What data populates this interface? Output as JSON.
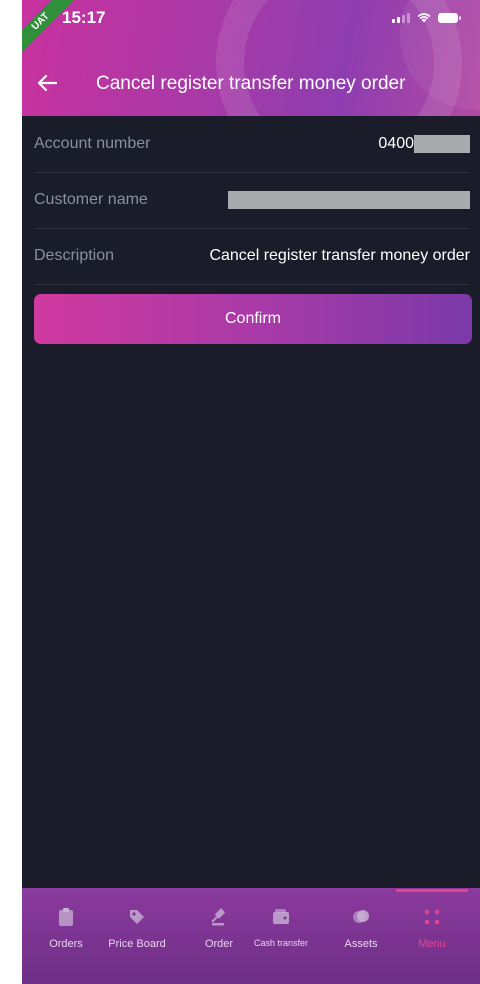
{
  "status_bar": {
    "time": "15:17",
    "env_badge": "UAT"
  },
  "header": {
    "title": "Cancel register transfer money order"
  },
  "form": {
    "account_number_label": "Account number",
    "account_number_value": "0400",
    "customer_name_label": "Customer name",
    "description_label": "Description",
    "description_value": "Cancel register transfer money order"
  },
  "actions": {
    "confirm_label": "Confirm"
  },
  "bottom_nav": {
    "orders": "Orders",
    "price_board": "Price Board",
    "order": "Order",
    "cash_transfer": "Cash transfer",
    "assets": "Assets",
    "menu": "Menu",
    "active": "menu"
  },
  "colors": {
    "accent": "#e0468f",
    "background": "#1a1d29",
    "header_gradient_start": "#c8329f",
    "header_gradient_end": "#8e3db0"
  }
}
